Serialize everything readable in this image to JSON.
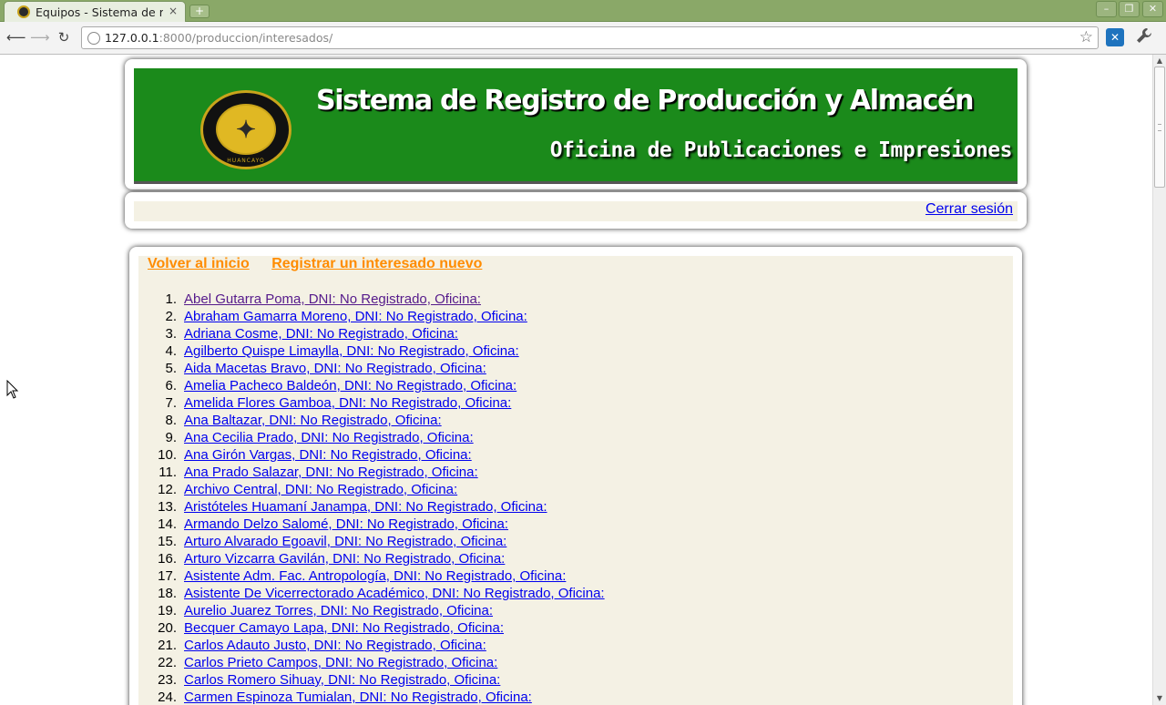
{
  "browser": {
    "tab_title": "Equipos - Sistema de re",
    "tab_close": "×",
    "new_tab": "+",
    "window_buttons": [
      "–",
      "❐",
      "✕"
    ],
    "nav": {
      "back": "⟵",
      "forward": "⟶",
      "reload": "↻"
    },
    "url_host": "127.0.0.1",
    "url_rest": ":8000/produccion/interesados/",
    "star": "☆",
    "ext_label": "✕",
    "wrench": "🔧"
  },
  "header": {
    "title": "Sistema de Registro de Producción y Almacén",
    "subtitle": "Oficina de Publicaciones e Impresiones",
    "logo_text": "HUANCAYO"
  },
  "userbar": {
    "logout_label": "Cerrar sesión"
  },
  "actions": {
    "home_label": "Volver al inicio",
    "register_label": "Registrar un interesado nuevo"
  },
  "interesados": [
    "Abel Gutarra Poma, DNI: No Registrado, Oficina:",
    "Abraham Gamarra Moreno, DNI: No Registrado, Oficina:",
    "Adriana Cosme, DNI: No Registrado, Oficina:",
    "Agilberto Quispe Limaylla, DNI: No Registrado, Oficina:",
    "Aida Macetas Bravo, DNI: No Registrado, Oficina:",
    "Amelia Pacheco Baldeón, DNI: No Registrado, Oficina:",
    "Amelida Flores Gamboa, DNI: No Registrado, Oficina:",
    "Ana Baltazar, DNI: No Registrado, Oficina:",
    "Ana Cecilia Prado, DNI: No Registrado, Oficina:",
    "Ana Girón Vargas, DNI: No Registrado, Oficina:",
    "Ana Prado Salazar, DNI: No Registrado, Oficina:",
    "Archivo Central, DNI: No Registrado, Oficina:",
    "Aristóteles Huamaní Janampa, DNI: No Registrado, Oficina:",
    "Armando Delzo Salomé, DNI: No Registrado, Oficina:",
    "Arturo Alvarado Egoavil, DNI: No Registrado, Oficina:",
    "Arturo Vizcarra Gavilán, DNI: No Registrado, Oficina:",
    "Asistente Adm. Fac. Antropología, DNI: No Registrado, Oficina:",
    "Asistente De Vicerrectorado Académico, DNI: No Registrado, Oficina:",
    "Aurelio Juarez Torres, DNI: No Registrado, Oficina:",
    "Becquer Camayo Lapa, DNI: No Registrado, Oficina:",
    "Carlos Adauto Justo, DNI: No Registrado, Oficina:",
    "Carlos Prieto Campos, DNI: No Registrado, Oficina:",
    "Carlos Romero Sihuay, DNI: No Registrado, Oficina:",
    "Carmen Espinoza Tumialan, DNI: No Registrado, Oficina:"
  ],
  "colors": {
    "banner": "#1b8a1b",
    "panel": "#f4f1e4",
    "link": "#0000ee",
    "visited_link": "#551a8b",
    "action_link": "#ff8c00"
  }
}
